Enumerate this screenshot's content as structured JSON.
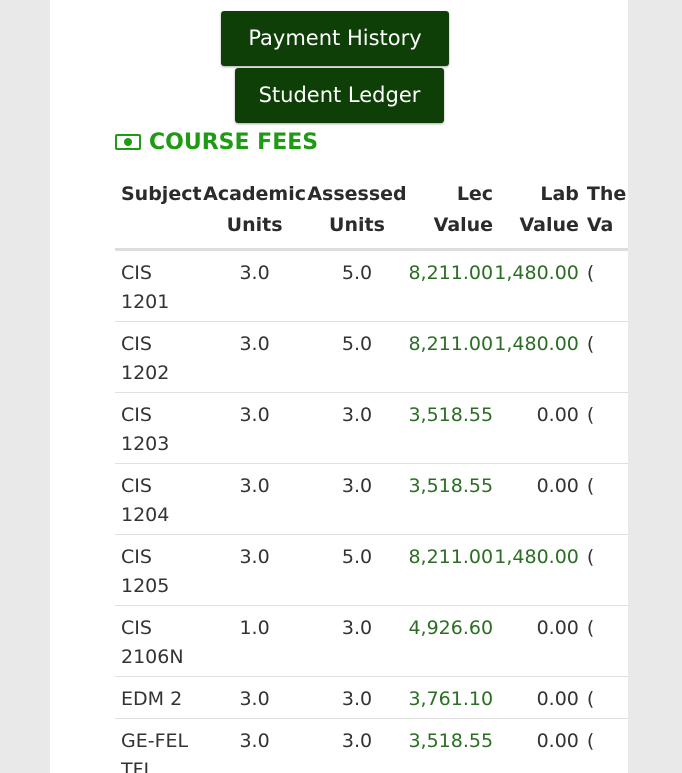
{
  "buttons": {
    "payment_history": "Payment History",
    "student_ledger": "Student Ledger"
  },
  "section": {
    "title": "COURSE FEES",
    "icon": "money-bill-icon"
  },
  "table": {
    "headers": {
      "subject": "Subject",
      "academic_units_1": "Academic",
      "academic_units_2": "Units",
      "assessed_units_1": "Assessed",
      "assessed_units_2": "Units",
      "lec_value_1": "Lec",
      "lec_value_2": "Value",
      "lab_value_1": "Lab",
      "lab_value_2": "Value",
      "the_value_1": "The",
      "the_value_2": "Va"
    },
    "rows": [
      {
        "subject": "CIS 1201",
        "academic": "3.0",
        "assessed": "5.0",
        "lec": "8,211.00",
        "lab": "1,480.00",
        "the": "("
      },
      {
        "subject": "CIS 1202",
        "academic": "3.0",
        "assessed": "5.0",
        "lec": "8,211.00",
        "lab": "1,480.00",
        "the": "("
      },
      {
        "subject": "CIS 1203",
        "academic": "3.0",
        "assessed": "3.0",
        "lec": "3,518.55",
        "lab": "0.00",
        "the": "("
      },
      {
        "subject": "CIS 1204",
        "academic": "3.0",
        "assessed": "3.0",
        "lec": "3,518.55",
        "lab": "0.00",
        "the": "("
      },
      {
        "subject": "CIS 1205",
        "academic": "3.0",
        "assessed": "5.0",
        "lec": "8,211.00",
        "lab": "1,480.00",
        "the": "("
      },
      {
        "subject": "CIS 2106N",
        "academic": "1.0",
        "assessed": "3.0",
        "lec": "4,926.60",
        "lab": "0.00",
        "the": "("
      },
      {
        "subject": "EDM 2",
        "academic": "3.0",
        "assessed": "3.0",
        "lec": "3,761.10",
        "lab": "0.00",
        "the": "("
      },
      {
        "subject": "GE-FEL TFL",
        "academic": "3.0",
        "assessed": "3.0",
        "lec": "3,518.55",
        "lab": "0.00",
        "the": "("
      }
    ]
  },
  "colors": {
    "button_bg": "#0e3f06",
    "section_title": "#1f9a14",
    "value_green": "#2b6e23"
  }
}
